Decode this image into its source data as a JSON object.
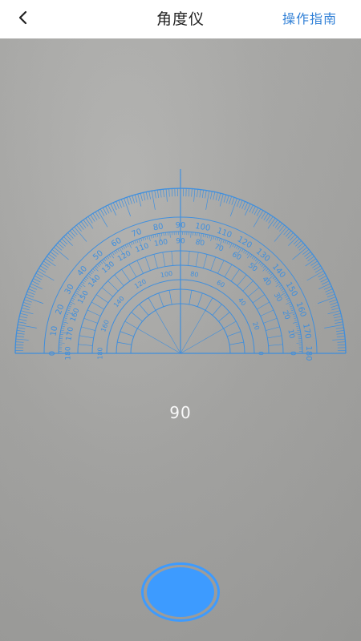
{
  "header": {
    "title": "角度仪",
    "guide_label": "操作指南",
    "back_icon": "chevron-left-icon"
  },
  "protractor": {
    "color": "#3d8fe0",
    "outer_scale_labels": [
      "0",
      "10",
      "20",
      "30",
      "40",
      "50",
      "60",
      "70",
      "80",
      "90",
      "100",
      "110",
      "120",
      "130",
      "140",
      "150",
      "160",
      "170",
      "180"
    ],
    "inner_scale_labels": [
      "180",
      "170",
      "160",
      "150",
      "140",
      "130",
      "120",
      "110",
      "100",
      "90",
      "80",
      "70",
      "60",
      "50",
      "40",
      "30",
      "20",
      "10",
      "0"
    ],
    "angle_value": 90
  },
  "readout": {
    "value": "90"
  },
  "shutter": {
    "color": "#3d9bff",
    "icon": "camera-shutter-icon"
  }
}
